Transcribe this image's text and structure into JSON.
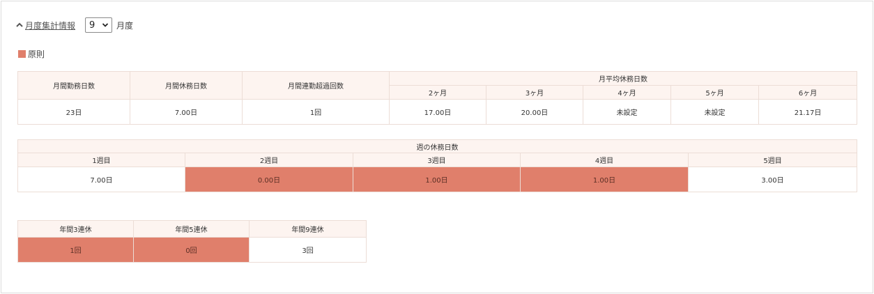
{
  "header": {
    "toggle_label": "月度集計情報",
    "selected_month": "9",
    "month_suffix": "月度"
  },
  "legend": {
    "label": "原則",
    "color": "#e07f6b"
  },
  "monthly_table": {
    "headers": {
      "work_days": "月間勤務日数",
      "holiday_days": "月間休務日数",
      "consecutive_excess": "月間連勤超過回数",
      "avg_group": "月平均休務日数",
      "avg_cols": [
        "2ヶ月",
        "3ヶ月",
        "4ヶ月",
        "5ヶ月",
        "6ヶ月"
      ]
    },
    "values": {
      "work_days": "23日",
      "holiday_days": "7.00日",
      "consecutive_excess": "1回",
      "avg": [
        "17.00日",
        "20.00日",
        "未設定",
        "未設定",
        "21.17日"
      ]
    }
  },
  "weekly_table": {
    "group_header": "週の休務日数",
    "weeks": [
      "1週目",
      "2週目",
      "3週目",
      "4週目",
      "5週目"
    ],
    "values": [
      "7.00日",
      "0.00日",
      "1.00日",
      "1.00日",
      "3.00日"
    ],
    "highlighted": [
      false,
      true,
      true,
      true,
      false
    ]
  },
  "yearly_table": {
    "headers": [
      "年間3連休",
      "年間5連休",
      "年間9連休"
    ],
    "values": [
      "1回",
      "0回",
      "3回"
    ],
    "highlighted": [
      true,
      true,
      false
    ]
  }
}
